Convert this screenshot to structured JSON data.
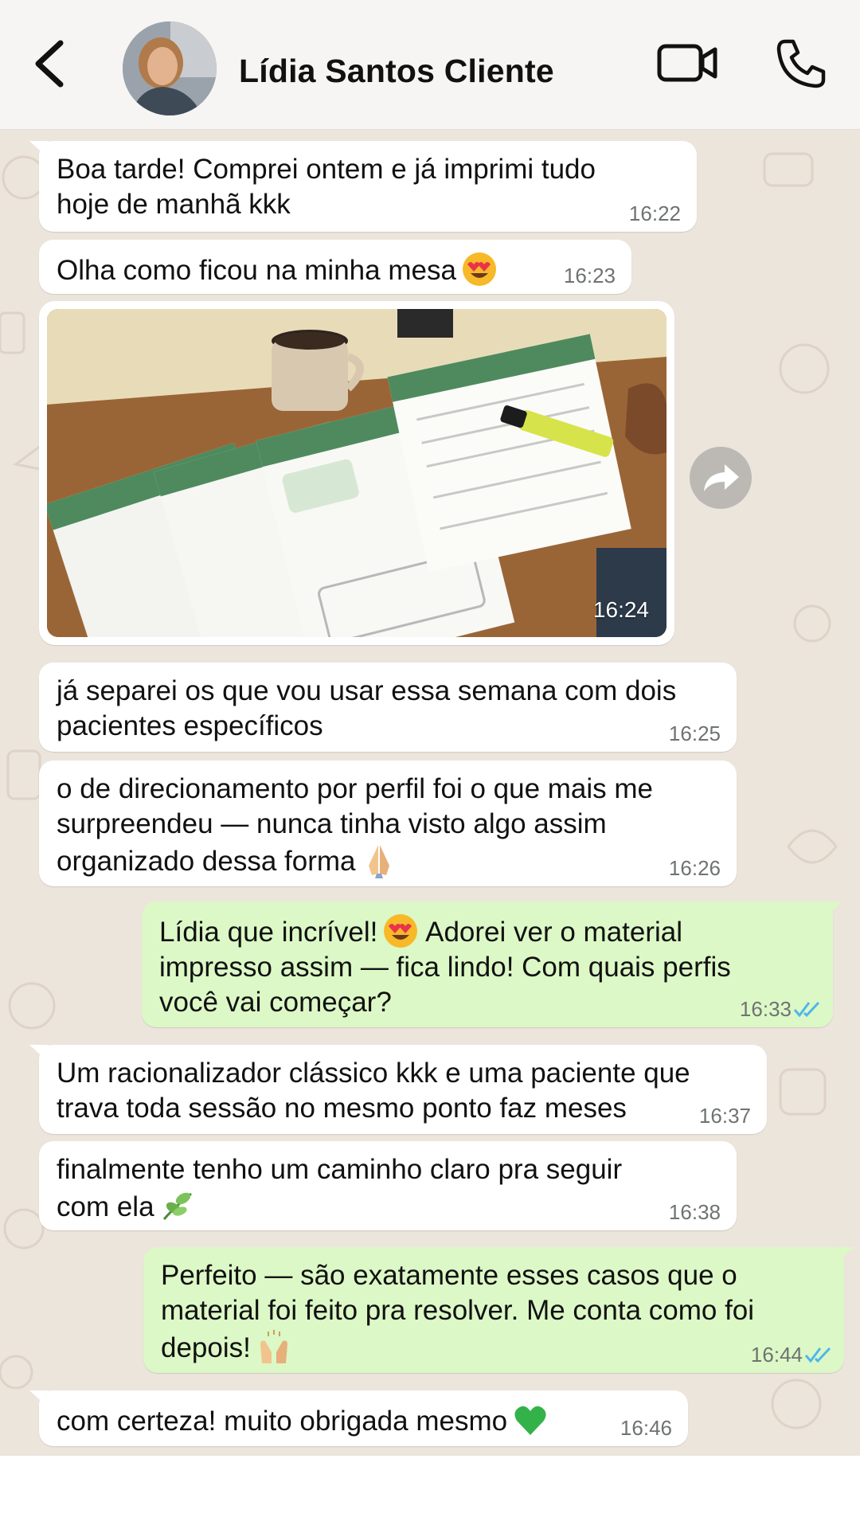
{
  "header": {
    "contact_name": "Lídia Santos Cliente",
    "back_icon": "chevron-left-icon",
    "video_icon": "video-camera-icon",
    "call_icon": "phone-icon"
  },
  "colors": {
    "incoming_bubble": "#ffffff",
    "outgoing_bubble": "#dcf8c6",
    "chat_background": "#ece5dc",
    "read_ticks": "#4fb6ec"
  },
  "messages": [
    {
      "direction": "in",
      "text": "Boa tarde! Comprei ontem e já imprimi tudo\nhoje de manhã kkk",
      "time": "16:22"
    },
    {
      "direction": "in",
      "text": "Olha como ficou na minha mesa",
      "emoji": "heart-eyes",
      "time": "16:23"
    },
    {
      "direction": "in",
      "type": "image",
      "image_description_icon": "photo-printed-worksheets",
      "time": "16:24"
    },
    {
      "direction": "in",
      "text": "já separei os que vou usar essa semana com dois\npacientes específicos",
      "time": "16:25"
    },
    {
      "direction": "in",
      "text": "o de direcionamento por perfil foi o que mais me\nsurpreendeu — nunca tinha visto algo assim\norganizado dessa forma",
      "emoji": "folded-hands",
      "time": "16:26"
    },
    {
      "direction": "out",
      "text_a": "Lídia que incrível!",
      "emoji": "heart-eyes",
      "text_b": " Adorei ver o material\nimpresso assim — fica lindo! Com quais perfis\nvocê vai começar?",
      "time": "16:33",
      "status": "read"
    },
    {
      "direction": "in",
      "text": "Um racionalizador clássico kkk e uma paciente que\ntrava toda sessão no mesmo ponto faz meses",
      "time": "16:37"
    },
    {
      "direction": "in",
      "text": "finalmente tenho um caminho claro pra seguir\ncom ela",
      "emoji": "herb",
      "time": "16:38"
    },
    {
      "direction": "out",
      "text": "Perfeito — são exatamente esses casos que o\nmaterial foi feito pra resolver. Me conta como foi\ndepois!",
      "emoji": "raising-hands",
      "time": "16:44",
      "status": "read"
    },
    {
      "direction": "in",
      "text": "com certeza! muito obrigada mesmo",
      "emoji": "green-heart",
      "time": "16:46"
    }
  ]
}
